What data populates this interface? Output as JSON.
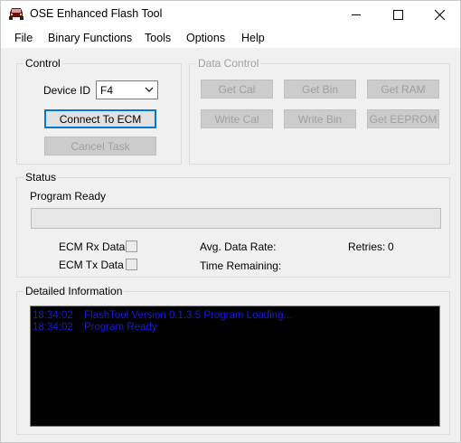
{
  "window": {
    "title": "OSE Enhanced Flash Tool",
    "controls": {
      "minimize": "minimize",
      "maximize": "maximize",
      "close": "close"
    }
  },
  "menu": [
    "File",
    "Binary Functions",
    "Tools",
    "Options",
    "Help"
  ],
  "control": {
    "label": "Control",
    "device_id_label": "Device ID",
    "device_id_value": "F4",
    "connect_label": "Connect To ECM",
    "cancel_label": "Cancel Task"
  },
  "data_control": {
    "label": "Data Control",
    "get_cal": "Get Cal",
    "get_bin": "Get Bin",
    "get_ram": "Get RAM",
    "write_cal": "Write Cal",
    "write_bin": "Write Bin",
    "get_eeprom": "Get EEPROM"
  },
  "status": {
    "label": "Status",
    "message": "Program Ready",
    "rx_label": "ECM Rx Data",
    "tx_label": "ECM Tx Data",
    "rx_checked": false,
    "tx_checked": false,
    "avg_rate_label": "Avg. Data Rate:",
    "avg_rate_value": "",
    "time_remaining_label": "Time Remaining:",
    "time_remaining_value": "",
    "retries_label": "Retries:",
    "retries_value": "0",
    "progress": 0
  },
  "details": {
    "label": "Detailed Information",
    "entries": [
      {
        "time": "18:34:02",
        "message": "FlashTool Version 0.1.3.5 Program Loading..."
      },
      {
        "time": "18:34:02",
        "message": "Program Ready"
      }
    ]
  },
  "colors": {
    "log_background": "#000000",
    "log_text": "#1a1ad8",
    "focus_border": "#0078d7"
  }
}
